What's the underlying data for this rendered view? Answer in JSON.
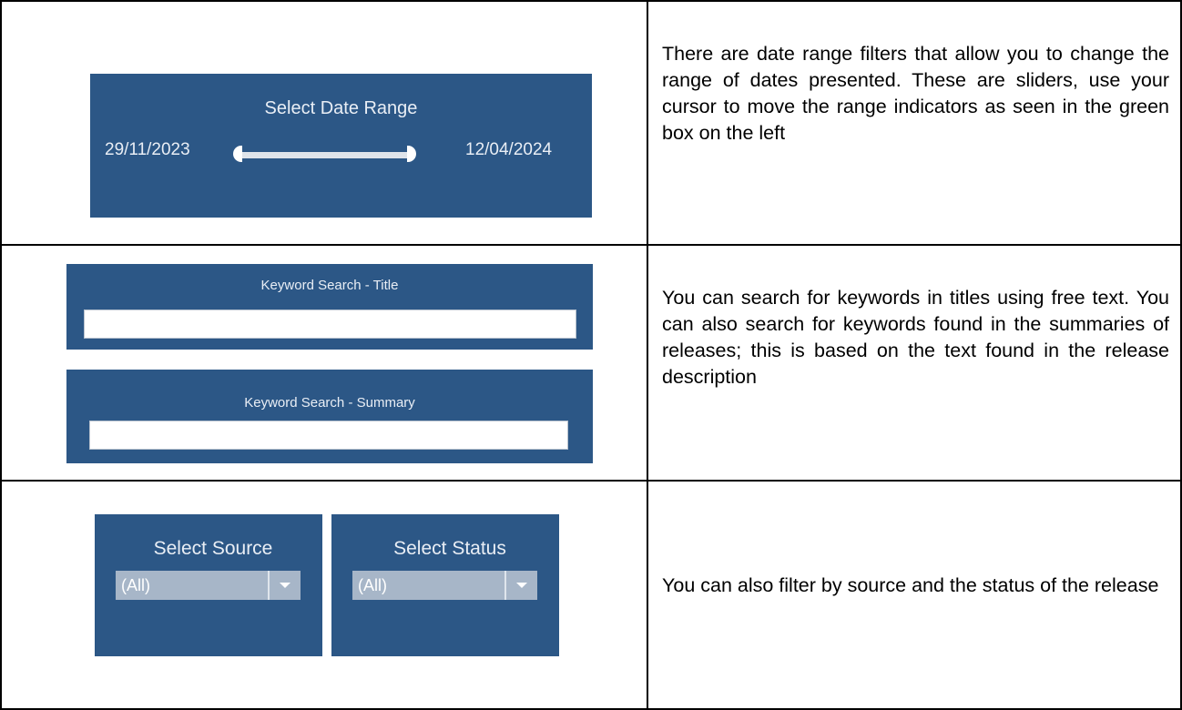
{
  "rows": [
    {
      "date_filter": {
        "title": "Select Date Range",
        "start": "29/11/2023",
        "end": "12/04/2024",
        "range_fraction": [
          0,
          1
        ]
      },
      "description": "There are date range filters that allow you to change the range of dates presented. These are sliders, use your cursor to move the range indicators as seen in the green box on the left"
    },
    {
      "keyword_title": {
        "label": "Keyword Search - Title",
        "value": ""
      },
      "keyword_summary": {
        "label": "Keyword  Search - Summary",
        "value": ""
      },
      "description": "You can search for keywords in titles using free text.  You can also search for keywords found in the summaries of releases; this is based on the text found in the release description"
    },
    {
      "source_filter": {
        "label": "Select Source",
        "value": "(All)",
        "icon": "chevron-down-icon"
      },
      "status_filter": {
        "label": "Select Status",
        "value": "(All)",
        "icon": "chevron-down-icon"
      },
      "description": "You can also filter by source and the status of the release"
    }
  ],
  "colors": {
    "panel": "#2c5786",
    "panel_text": "#e9eef5",
    "select_box": "#a7b6c8",
    "border": "#000000"
  }
}
